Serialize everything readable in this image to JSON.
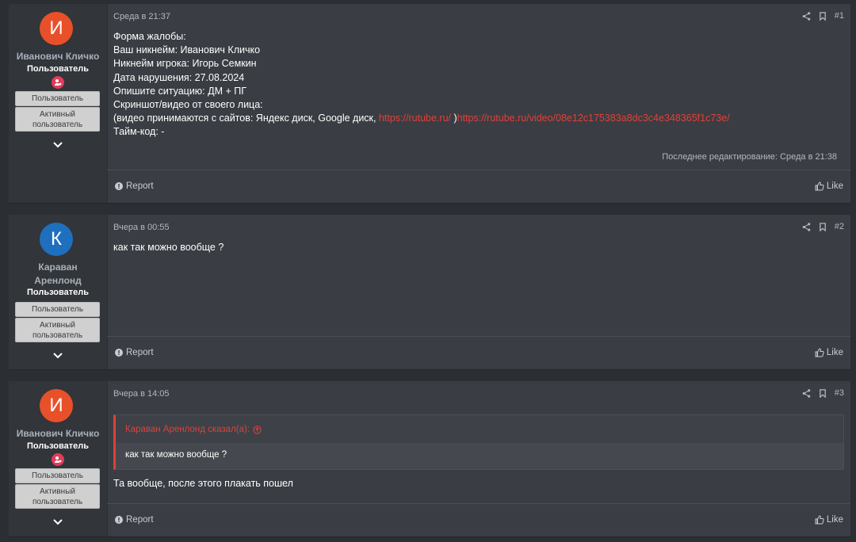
{
  "posts": [
    {
      "author": "Иванович Кличко",
      "avatar_letter": "И",
      "avatar_color": "#e8502a",
      "user_title": "Пользователь",
      "banners": [
        "Пользователь",
        "Активный пользователь"
      ],
      "date": "Среда в 21:37",
      "number": "#1",
      "lines": [
        "Форма жалобы:",
        "Ваш никнейм: Иванович Кличко",
        "Никнейм игрока: Игорь Семкин",
        "Дата нарушения: 27.08.2024",
        "Опишите ситуацию: ДМ + ПГ",
        "Скриншот/видео от своего лица:"
      ],
      "video_line_prefix": "(видео принимаются с сайтов: Яндекс диск, Google диск, ",
      "link1": "https://rutube.ru/",
      "video_line_mid": " )",
      "link2": "https://rutube.ru/video/08e12c175383a8dc3c4e348365f1c73e/",
      "timecode": "Тайм-код: -",
      "edited": "Последнее редактирование: Среда в 21:38",
      "report": "Report",
      "like": "Like"
    },
    {
      "author": "Караван Аренлонд",
      "avatar_letter": "К",
      "avatar_color": "#1f6fbf",
      "user_title": "Пользователь",
      "banners": [
        "Пользователь",
        "Активный пользователь"
      ],
      "date": "Вчера в 00:55",
      "number": "#2",
      "text": "как так можно вообще ?",
      "report": "Report",
      "like": "Like"
    },
    {
      "author": "Иванович Кличко",
      "avatar_letter": "И",
      "avatar_color": "#e8502a",
      "user_title": "Пользователь",
      "banners": [
        "Пользователь",
        "Активный пользователь"
      ],
      "date": "Вчера в 14:05",
      "number": "#3",
      "quote_author": "Караван Аренлонд сказал(а):",
      "quote_text": "как так можно вообще ?",
      "text": "Та вообще, после этого плакать пошел",
      "report": "Report",
      "like": "Like"
    }
  ]
}
